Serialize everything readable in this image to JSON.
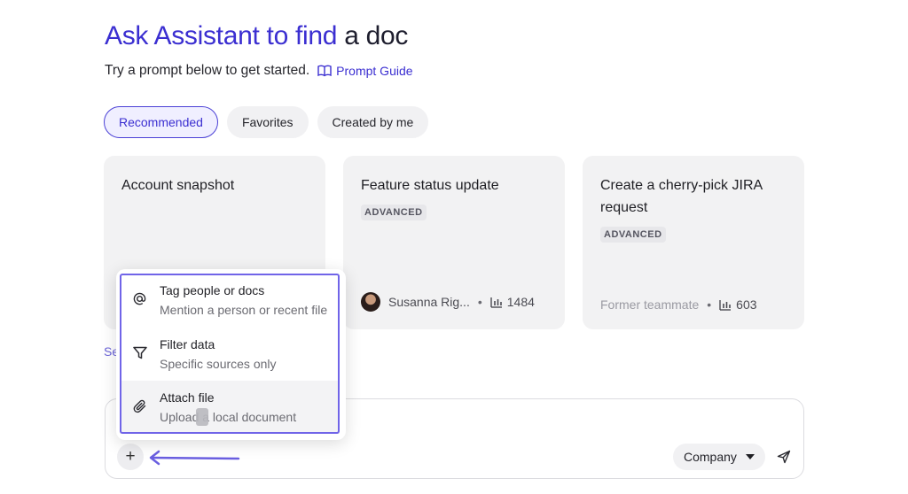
{
  "header": {
    "title_accent": "Ask Assistant to find",
    "title_rest": " a doc",
    "subtitle": "Try a prompt below to get started.",
    "guide_label": "Prompt Guide"
  },
  "tabs": [
    {
      "label": "Recommended",
      "active": true
    },
    {
      "label": "Favorites",
      "active": false
    },
    {
      "label": "Created by me",
      "active": false
    }
  ],
  "cards": [
    {
      "title": "Account snapshot",
      "badge": "",
      "author": "",
      "count": ""
    },
    {
      "title": "Feature status update",
      "badge": "ADVANCED",
      "author": "Susanna Rig...",
      "count": "1484"
    },
    {
      "title": "Create a cherry-pick JIRA request",
      "badge": "ADVANCED",
      "author": "Former teammate",
      "count": "603"
    }
  ],
  "see_more_partial": "Se",
  "menu": {
    "items": [
      {
        "icon": "at-icon",
        "label": "Tag people or docs",
        "desc": "Mention a person or recent file"
      },
      {
        "icon": "filter-icon",
        "label": "Filter data",
        "desc": "Specific sources only"
      },
      {
        "icon": "paperclip-icon",
        "label": "Attach file",
        "desc": "Upload a local document"
      }
    ]
  },
  "composer": {
    "plus_label": "+",
    "scope_label": "Company"
  },
  "colors": {
    "accent": "#3b2fd1",
    "highlight": "#7064e8",
    "card_bg": "#f2f2f3"
  }
}
